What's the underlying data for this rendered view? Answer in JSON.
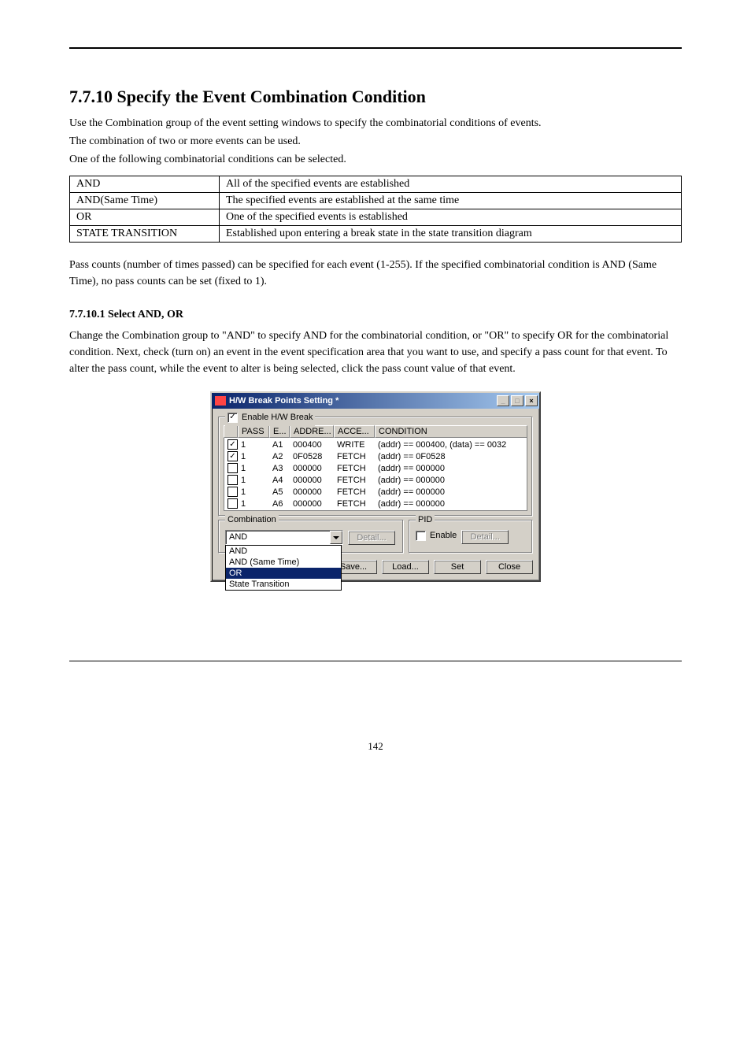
{
  "section": {
    "heading": "7.7.10 Specify the Event Combination Condition",
    "para1": "Use the Combination group of the event setting windows to specify the combinatorial conditions of events.",
    "para2": "The combination of two or more events can be used.",
    "para3": "One of the following combinatorial conditions can be selected.",
    "table": [
      {
        "k": "AND",
        "v": "All of the specified events are established"
      },
      {
        "k": "AND(Same Time)",
        "v": "The specified events are established at the same time"
      },
      {
        "k": "OR",
        "v": "One of the specified events is established"
      },
      {
        "k": "STATE TRANSITION",
        "v": "Established upon entering a break state in the state transition diagram"
      }
    ],
    "para4": "Pass counts (number of times passed) can be specified for each event (1-255). If the specified combinatorial condition is AND (Same Time), no pass counts can be set (fixed to 1).",
    "sub_heading": "7.7.10.1 Select AND, OR",
    "para5": "Change the Combination group to \"AND\" to specify AND for the combinatorial condition, or \"OR\" to specify OR for the combinatorial condition. Next, check (turn on) an event in the event specification area that you want to use, and specify a pass count for that event. To alter the pass count, while the event to alter is being selected, click the pass count value of that event."
  },
  "dialog": {
    "title": "H/W Break Points Setting *",
    "enable": {
      "label": "Enable H/W Break",
      "checked": true
    },
    "headers": {
      "pass": "PASS",
      "e": "E...",
      "addr": "ADDRE...",
      "acc": "ACCE...",
      "cond": "CONDITION"
    },
    "rows": [
      {
        "on": true,
        "pass": "1",
        "e": "A1",
        "addr": "000400",
        "acc": "WRITE",
        "cond": "(addr) == 000400, (data) == 0032"
      },
      {
        "on": true,
        "pass": "1",
        "e": "A2",
        "addr": "0F0528",
        "acc": "FETCH",
        "cond": "(addr) == 0F0528"
      },
      {
        "on": false,
        "pass": "1",
        "e": "A3",
        "addr": "000000",
        "acc": "FETCH",
        "cond": "(addr) == 000000"
      },
      {
        "on": false,
        "pass": "1",
        "e": "A4",
        "addr": "000000",
        "acc": "FETCH",
        "cond": "(addr) == 000000"
      },
      {
        "on": false,
        "pass": "1",
        "e": "A5",
        "addr": "000000",
        "acc": "FETCH",
        "cond": "(addr) == 000000"
      },
      {
        "on": false,
        "pass": "1",
        "e": "A6",
        "addr": "000000",
        "acc": "FETCH",
        "cond": "(addr) == 000000"
      }
    ],
    "combination": {
      "label": "Combination",
      "value": "AND",
      "options": [
        "AND",
        "AND (Same Time)",
        "OR",
        "State Transition"
      ],
      "selected_option": "OR",
      "detail": "Detail..."
    },
    "pid": {
      "label": "PID",
      "enable": "Enable",
      "enable_checked": false,
      "detail": "Detail..."
    },
    "buttons": {
      "save": "Save...",
      "load": "Load...",
      "set": "Set",
      "close": "Close"
    },
    "win_buttons": {
      "min": "_",
      "max": "□",
      "close": "×"
    }
  },
  "page_number": "142"
}
